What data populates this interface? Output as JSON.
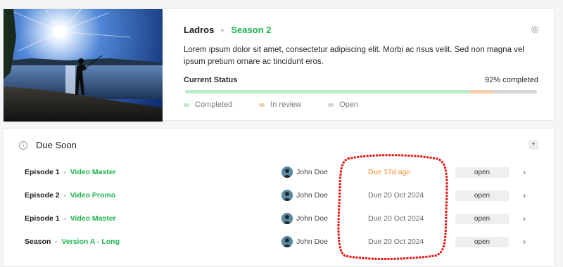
{
  "project": {
    "name": "Ladros",
    "season": "Season 2",
    "description": "Lorem ipsum dolor sit amet, consectetur adipiscing elit. Morbi ac risus velit. Sed non magna vel ipsum pretium ornare ac tincidunt eros.",
    "status_label": "Current Status",
    "status_percent_text": "92% completed",
    "progress": {
      "completed": 0.81,
      "in_review": 0.065,
      "open": 0.125
    },
    "legend": [
      {
        "label": "Completed",
        "color": "#b8ebc7"
      },
      {
        "label": "In review",
        "color": "#f2cfa7"
      },
      {
        "label": "Open",
        "color": "#d5d6da"
      }
    ],
    "icons": {
      "settings": "gear-icon"
    }
  },
  "due_soon": {
    "title": "Due Soon",
    "icons": {
      "info": "info-icon",
      "collapse": "caret-down-icon",
      "row_action": "chevron-right-icon"
    },
    "rows": [
      {
        "episode": "Episode 1",
        "version": "Video Master",
        "assignee": "John Doe",
        "due": "Due 17d ago",
        "overdue": true,
        "status": "open"
      },
      {
        "episode": "Episode 2",
        "version": "Video Promo",
        "assignee": "John Doe",
        "due": "Due 20 Oct 2024",
        "overdue": false,
        "status": "open"
      },
      {
        "episode": "Episode 1",
        "version": "Video Master",
        "assignee": "John Doe",
        "due": "Due 20 Oct 2024",
        "overdue": false,
        "status": "open"
      },
      {
        "episode": "Season",
        "version": "Version A - Long",
        "assignee": "John Doe",
        "due": "Due 20 Oct 2024",
        "overdue": false,
        "status": "open"
      }
    ]
  },
  "colors": {
    "accent_green": "#20b44f",
    "overdue_orange": "#f08a1c",
    "annotation_red": "#e8130f"
  }
}
